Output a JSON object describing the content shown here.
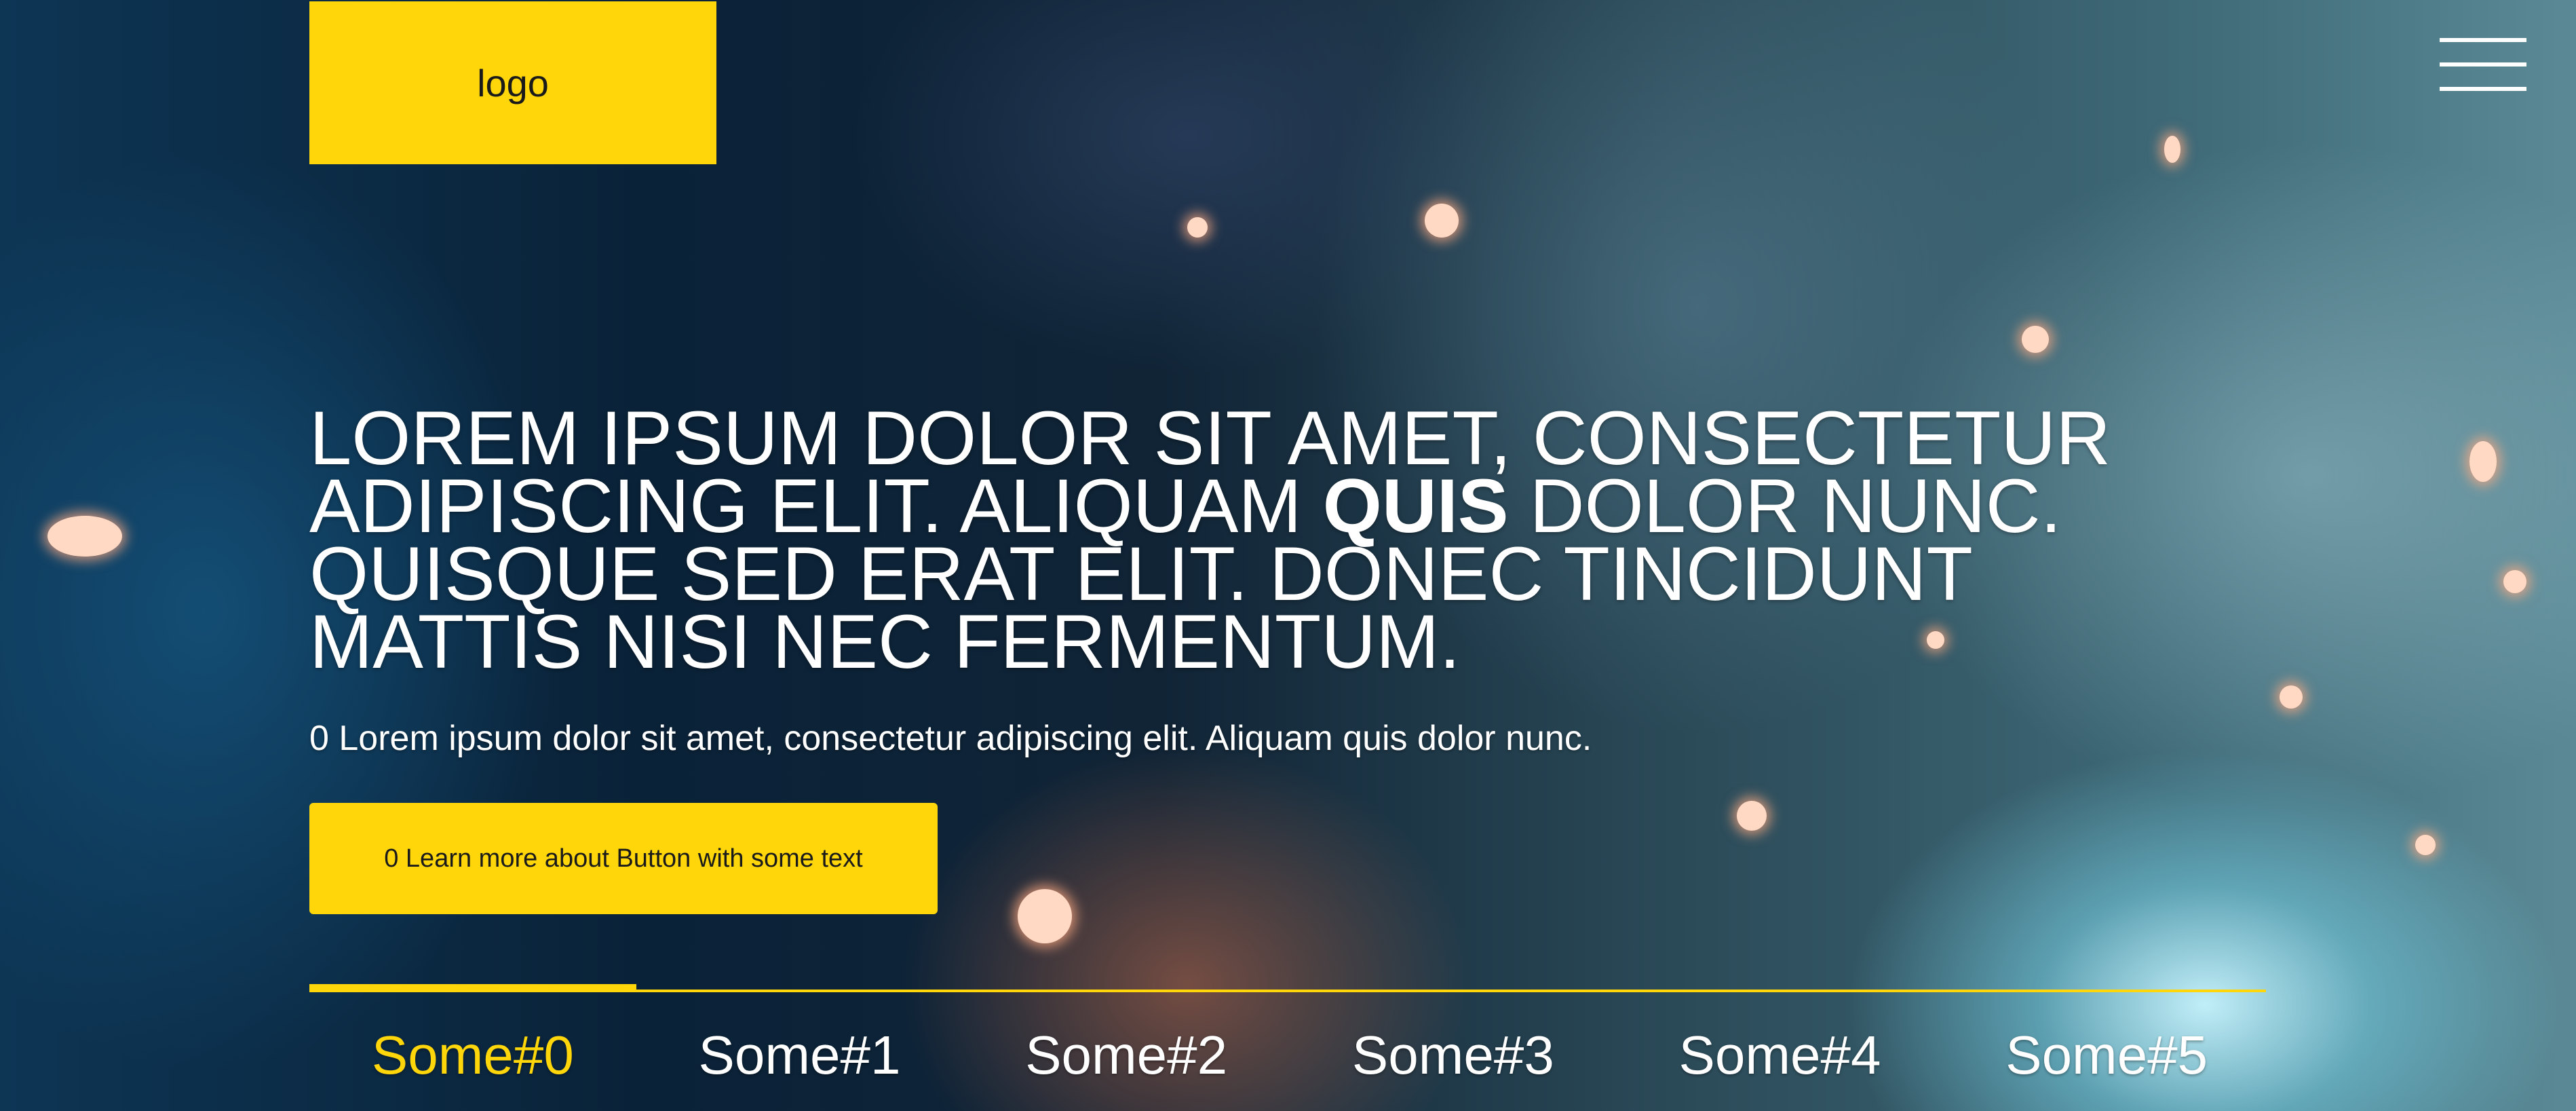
{
  "header": {
    "logo_text": "logo",
    "menu_icon": "hamburger-menu-icon"
  },
  "hero": {
    "background_icon": "welder-sparks-photo",
    "headline_lines": [
      {
        "before": "LOREM IPSUM DOLOR SIT AMET, CONSECTETUR",
        "bold": "",
        "after": ""
      },
      {
        "before": "ADIPISCING ELIT. ALIQUAM ",
        "bold": "QUIS",
        "after": " DOLOR NUNC."
      },
      {
        "before": "QUISQUE SED ERAT ELIT. DONEC TINCIDUNT",
        "bold": "",
        "after": ""
      },
      {
        "before": "MATTIS NISI NEC FERMENTUM.",
        "bold": "",
        "after": ""
      }
    ],
    "subtitle": "0 Lorem ipsum dolor sit amet, consectetur adipiscing elit. Aliquam quis dolor nunc.",
    "cta_label": "0 Learn more about Button with some text"
  },
  "tabs": {
    "active_index": 0,
    "items": [
      {
        "label": "Some#0"
      },
      {
        "label": "Some#1"
      },
      {
        "label": "Some#2"
      },
      {
        "label": "Some#3"
      },
      {
        "label": "Some#4"
      },
      {
        "label": "Some#5"
      }
    ]
  },
  "colors": {
    "accent": "#ffd60a",
    "text": "#ffffff",
    "button_text": "#1a1a1a"
  }
}
